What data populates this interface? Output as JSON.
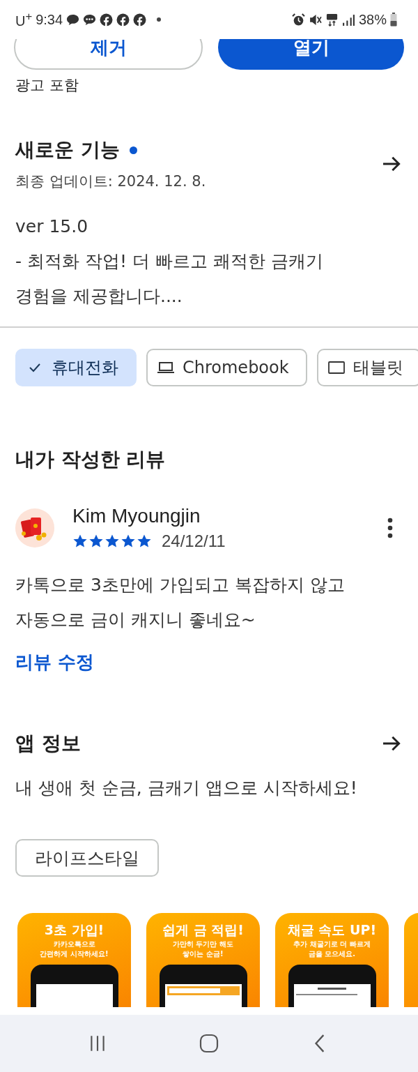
{
  "status_bar": {
    "carrier": "U$^{+}$",
    "time": "9:34",
    "battery": "38%"
  },
  "top_buttons": [
    {
      "label": "제거",
      "kind": "outline"
    },
    {
      "label": "열기",
      "kind": "filled"
    }
  ],
  "ad_notice": "광고 포함",
  "whats_new": {
    "title": "새로운 기능",
    "unread": true,
    "updated": "최종 업데이트: 2024. 12. 8.",
    "version": "ver 15.0",
    "notes": [
      "- 최적화 작업! 더 빠르고 쾌적한 금캐기",
      "경험을 제공합니다...."
    ]
  },
  "device_tabs": [
    {
      "label": "휴대전화",
      "selected": true
    },
    {
      "label": "Chromebook",
      "kind": "laptop",
      "selected": false
    },
    {
      "label": "태블릿",
      "kind": "tablet",
      "selected": false
    }
  ],
  "my_review": {
    "heading": "내가 작성한 리뷰",
    "reviewer": "Kim Myoungjin",
    "stars": 5,
    "date": "24/12/11",
    "text": [
      "카톡으로 3초만에 가입되고 복잡하지 않고",
      "자동으로 금이 캐지니 좋네요~"
    ],
    "edit_link": "리뷰 수정"
  },
  "app_info": {
    "heading": "앱 정보",
    "description": "내 생애 첫 순금, 금캐기 앱으로 시작하세요!",
    "category": "라이프스타일"
  },
  "screenshots": [
    {
      "title": "3초 가입!",
      "subtitle": [
        "카카오톡으로",
        "간편하게 시작하세요!"
      ],
      "kind": "blank"
    },
    {
      "title": "쉽게 금 적립!",
      "subtitle": [
        "가만히 두기만 해도",
        "쌓이는 순금!"
      ],
      "kind": "balance"
    },
    {
      "title": "채굴 속도 UP!",
      "subtitle": [
        "추가 채굴기로 더 빠르게",
        "금을 모으세요."
      ],
      "kind": "list"
    },
    {
      "kind": "edge"
    }
  ]
}
